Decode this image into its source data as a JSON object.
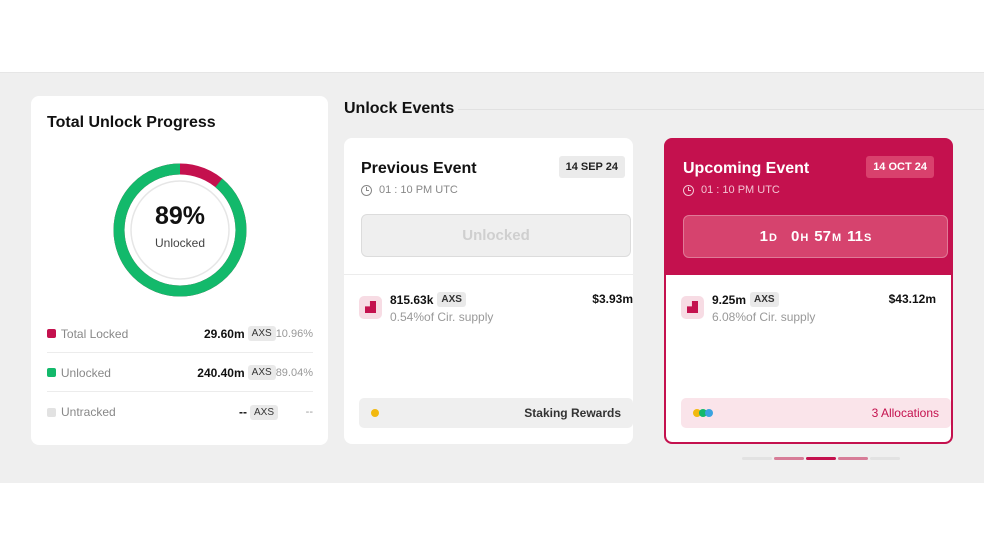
{
  "progress": {
    "title": "Total Unlock Progress",
    "percent_label": "89%",
    "center_sub": "Unlocked",
    "unlocked_fraction": 0.8904,
    "colors": {
      "locked": "#c4114e",
      "unlocked": "#13b96b",
      "untracked": "#e2e2e2"
    },
    "legend": [
      {
        "label": "Total Locked",
        "value": "29.60m",
        "token": "AXS",
        "pct": "10.96%",
        "color": "#c4114e"
      },
      {
        "label": "Unlocked",
        "value": "240.40m",
        "token": "AXS",
        "pct": "89.04%",
        "color": "#13b96b"
      },
      {
        "label": "Untracked",
        "value": "--",
        "token": "AXS",
        "pct": "--",
        "color": "#e2e2e2"
      }
    ]
  },
  "events_section": {
    "title": "Unlock Events"
  },
  "previous": {
    "title": "Previous Event",
    "date": "14 SEP 24",
    "time": "01 : 10 PM UTC",
    "button_label": "Unlocked",
    "amount": "815.63k",
    "token": "AXS",
    "supply": "0.54%of Cir. supply",
    "usd": "$3.93m",
    "allocation_label": "Staking Rewards",
    "allocation_dot_color": "#f2b90f"
  },
  "upcoming": {
    "title": "Upcoming Event",
    "date": "14 OCT 24",
    "time": "01 : 10 PM UTC",
    "countdown": {
      "days": "1",
      "days_unit": "D",
      "hours": "0",
      "hours_unit": "H",
      "minutes": "57",
      "minutes_unit": "M",
      "seconds": "11",
      "seconds_unit": "S"
    },
    "amount": "9.25m",
    "token": "AXS",
    "supply": "6.08%of Cir. supply",
    "usd": "$43.12m",
    "allocation_label": "3 Allocations",
    "allocation_dot_colors": [
      "#f2b90f",
      "#13b96b",
      "#3aa3e0"
    ]
  },
  "pager": {
    "active_index": 2,
    "count": 5
  }
}
